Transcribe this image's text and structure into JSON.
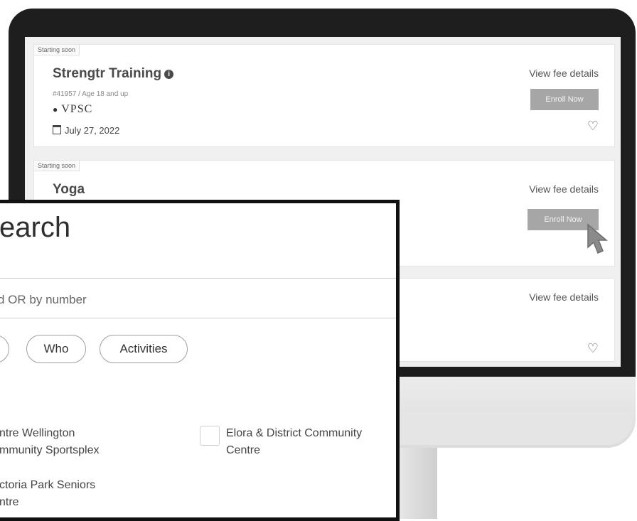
{
  "activities": [
    {
      "badge": "Starting soon",
      "title": "Strengtr Training",
      "meta": "#41957 / Age 18 and up",
      "location": "VPSC",
      "date": "July 27, 2022",
      "fee_link": "View fee details",
      "enroll": "Enroll Now"
    },
    {
      "badge": "Starting soon",
      "title": "Yoga",
      "fee_link": "View fee details",
      "enroll": "Enroll Now"
    },
    {
      "fee_link": "View fee details"
    }
  ],
  "search": {
    "title": "earch",
    "placeholder": "d OR by number",
    "filters": [
      "",
      "Who",
      "Activities"
    ],
    "locations": [
      {
        "label": "ntre Wellington\nmmunity Sportsplex",
        "checkbox": false
      },
      {
        "label": "ctoria Park Seniors\nntre",
        "checkbox": false
      },
      {
        "label": "Elora & District Community\nCentre",
        "checkbox": true
      }
    ]
  },
  "icons": {
    "location": "map-pin-icon",
    "date": "calendar-icon",
    "favorite": "heart-icon",
    "info": "info-icon",
    "pointer": "cursor-arrow-icon"
  },
  "colors": {
    "bezel": "#1e1e1e",
    "enroll_button": "#a6a6a6",
    "panel_border": "#111111"
  }
}
